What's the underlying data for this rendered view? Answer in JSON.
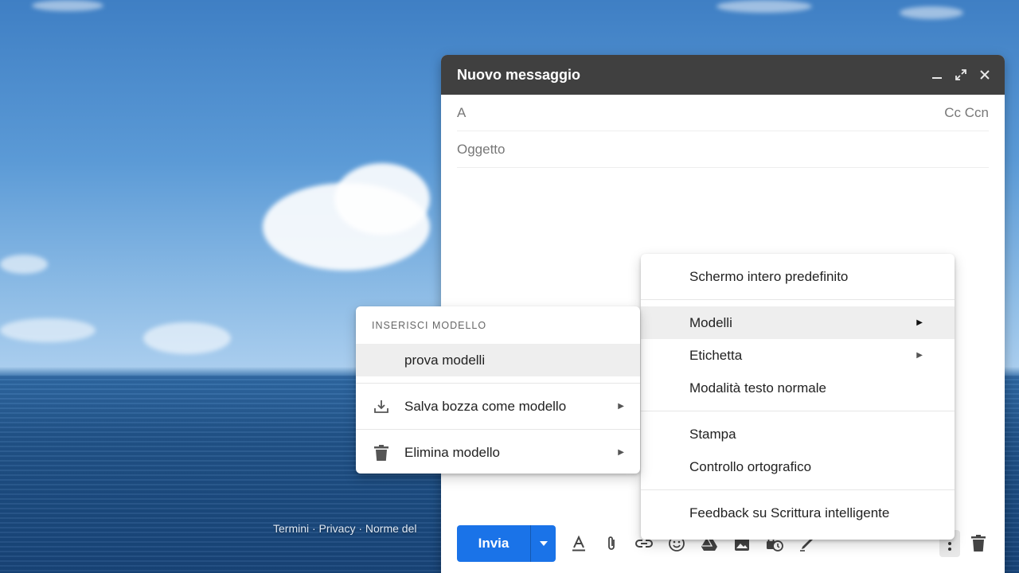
{
  "compose": {
    "title": "Nuovo messaggio",
    "to_label": "A",
    "cc_bcc_label": "Cc Ccn",
    "subject_placeholder": "Oggetto",
    "send_label": "Invia"
  },
  "footer": {
    "links": "Termini · Privacy · Norme del"
  },
  "more_menu": {
    "items": [
      {
        "label": "Schermo intero predefinito"
      },
      {
        "label": "Modelli"
      },
      {
        "label": "Etichetta"
      },
      {
        "label": "Modalità testo normale"
      },
      {
        "label": "Stampa"
      },
      {
        "label": "Controllo ortografico"
      },
      {
        "label": "Feedback su Scrittura intelligente"
      }
    ]
  },
  "templates_menu": {
    "header": "INSERISCI MODELLO",
    "items": [
      {
        "label": "prova modelli"
      },
      {
        "label": "Salva bozza come modello"
      },
      {
        "label": "Elimina modello"
      }
    ]
  },
  "colors": {
    "send": "#1a73e8",
    "header": "#404040"
  }
}
